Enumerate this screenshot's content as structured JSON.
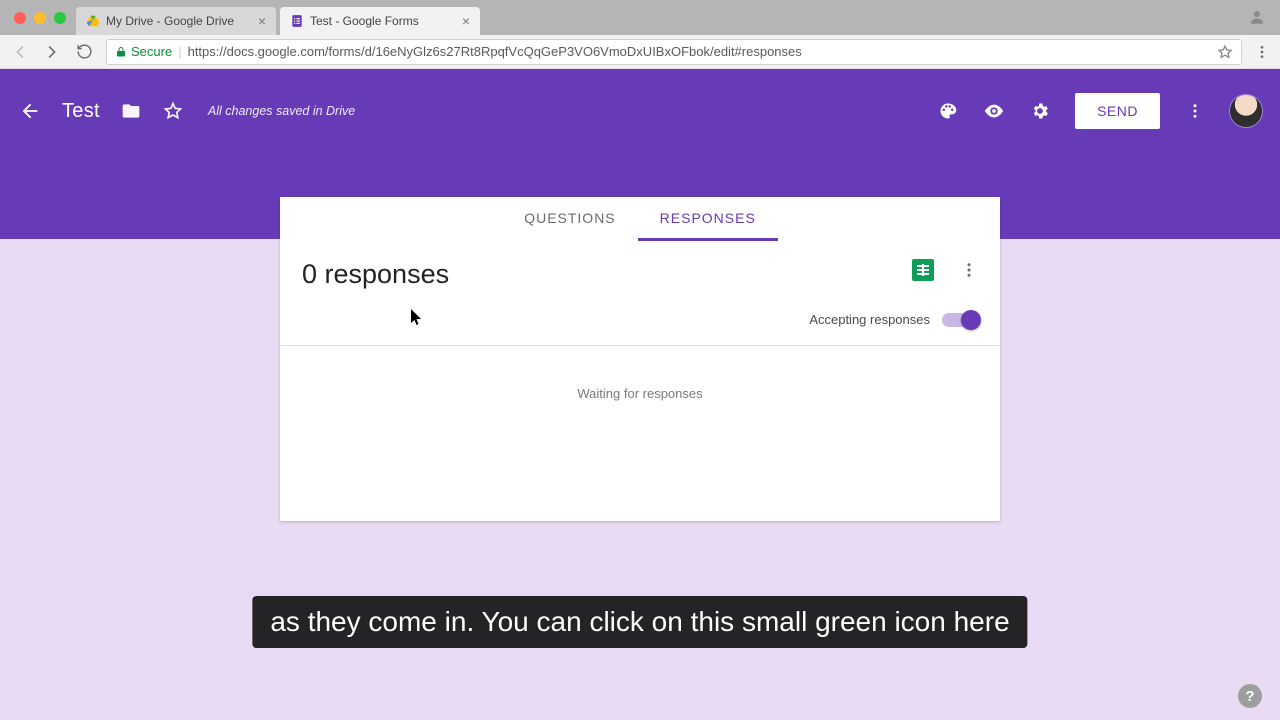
{
  "browser": {
    "tabs": [
      {
        "title": "My Drive - Google Drive"
      },
      {
        "title": "Test - Google Forms"
      }
    ],
    "secure_label": "Secure",
    "url": "https://docs.google.com/forms/d/16eNyGlz6s27Rt8RpqfVcQqGeP3VO6VmoDxUIBxOFbok/edit#responses"
  },
  "header": {
    "form_title": "Test",
    "save_status": "All changes saved in Drive",
    "send_label": "SEND"
  },
  "tabs": {
    "questions": "QUESTIONS",
    "responses": "RESPONSES"
  },
  "responses": {
    "count_text": "0 responses",
    "accepting_label": "Accepting responses",
    "waiting_text": "Waiting for responses"
  },
  "caption": "as they come in. You can click on this small green icon here",
  "help_glyph": "?"
}
